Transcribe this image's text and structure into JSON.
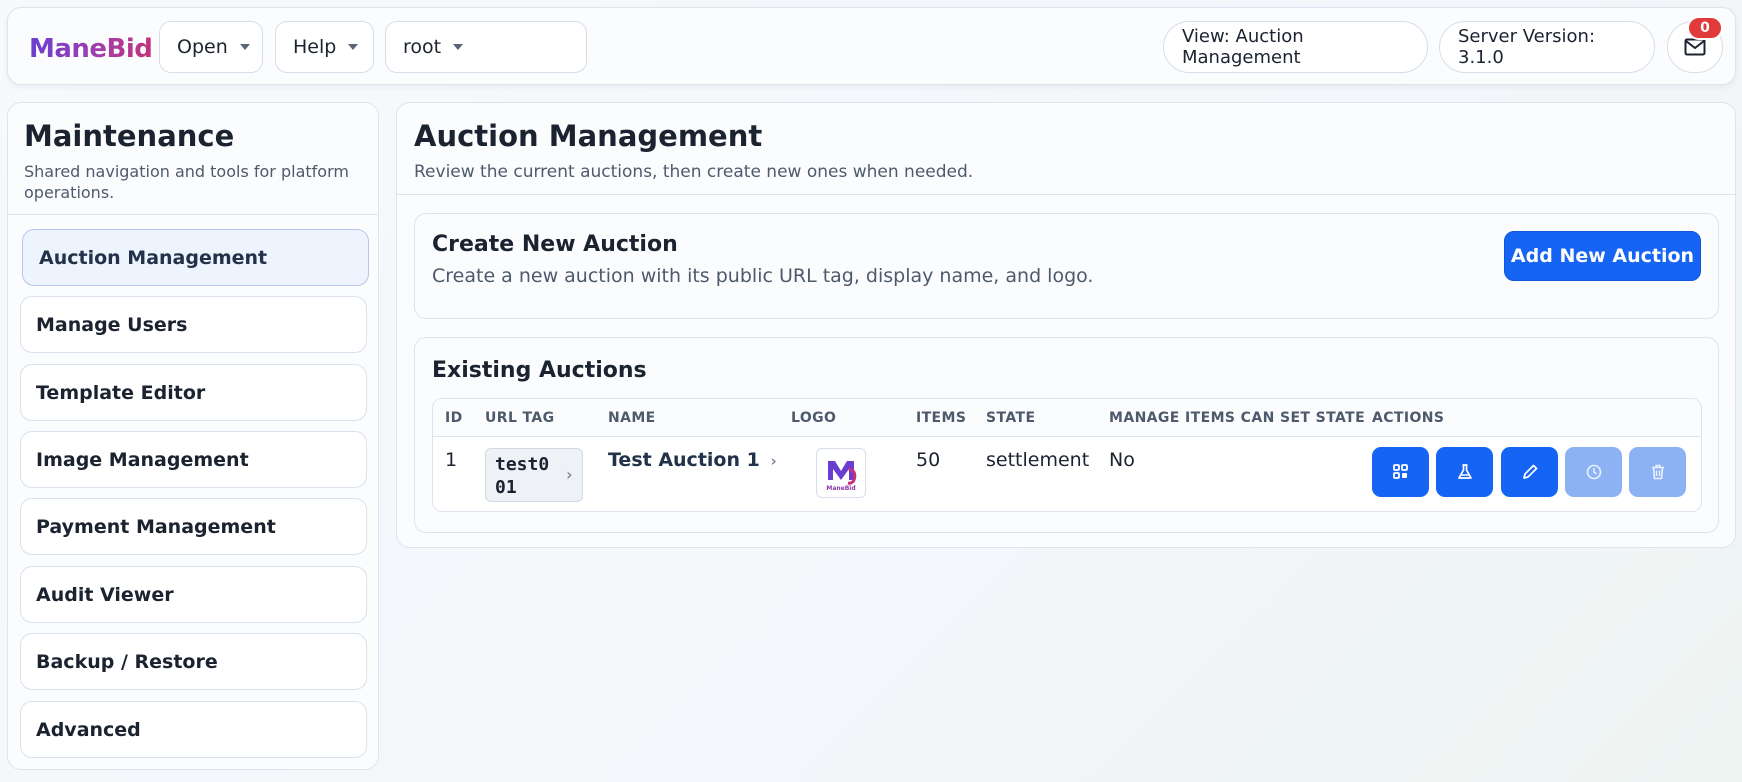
{
  "header": {
    "brand": "ManeBid",
    "menus": [
      {
        "label": "Open"
      },
      {
        "label": "Help"
      },
      {
        "label": "root"
      }
    ],
    "view_label": "View: Auction Management",
    "server_version": "Server Version: 3.1.0",
    "mail_badge": "0"
  },
  "sidebar": {
    "title": "Maintenance",
    "subtitle": "Shared navigation and tools for platform operations.",
    "items": [
      {
        "label": "Auction Management",
        "active": true
      },
      {
        "label": "Manage Users"
      },
      {
        "label": "Template Editor"
      },
      {
        "label": "Image Management"
      },
      {
        "label": "Payment Management"
      },
      {
        "label": "Audit Viewer"
      },
      {
        "label": "Backup / Restore"
      },
      {
        "label": "Advanced"
      }
    ]
  },
  "main": {
    "title": "Auction Management",
    "subtitle": "Review the current auctions, then create new ones when needed.",
    "create_card": {
      "title": "Create New Auction",
      "subtitle": "Create a new auction with its public URL tag, display name, and logo.",
      "button_label": "Add New Auction"
    },
    "existing_card": {
      "title": "Existing Auctions",
      "columns": [
        "ID",
        "URL TAG",
        "NAME",
        "LOGO",
        "ITEMS",
        "STATE",
        "MANAGE ITEMS CAN SET STATE",
        "ACTIONS"
      ],
      "rows": [
        {
          "id": "1",
          "url_tag_line1": "test0",
          "url_tag_line2": "01",
          "name": "Test Auction 1",
          "logo_text": "ManeBid",
          "items": "50",
          "state": "settlement",
          "manage_items_can_set_state": "No",
          "actions": [
            {
              "icon": "grid-icon",
              "enabled": true
            },
            {
              "icon": "flask-icon",
              "enabled": true
            },
            {
              "icon": "pencil-icon",
              "enabled": true
            },
            {
              "icon": "history-icon",
              "enabled": false
            },
            {
              "icon": "trash-icon",
              "enabled": false
            }
          ]
        }
      ]
    }
  },
  "colors": {
    "primary": "#1664f4",
    "primary_disabled": "#8db2f4",
    "badge": "#e03a3a",
    "brand_start": "#6a3fd0",
    "brand_end": "#c4307a"
  }
}
